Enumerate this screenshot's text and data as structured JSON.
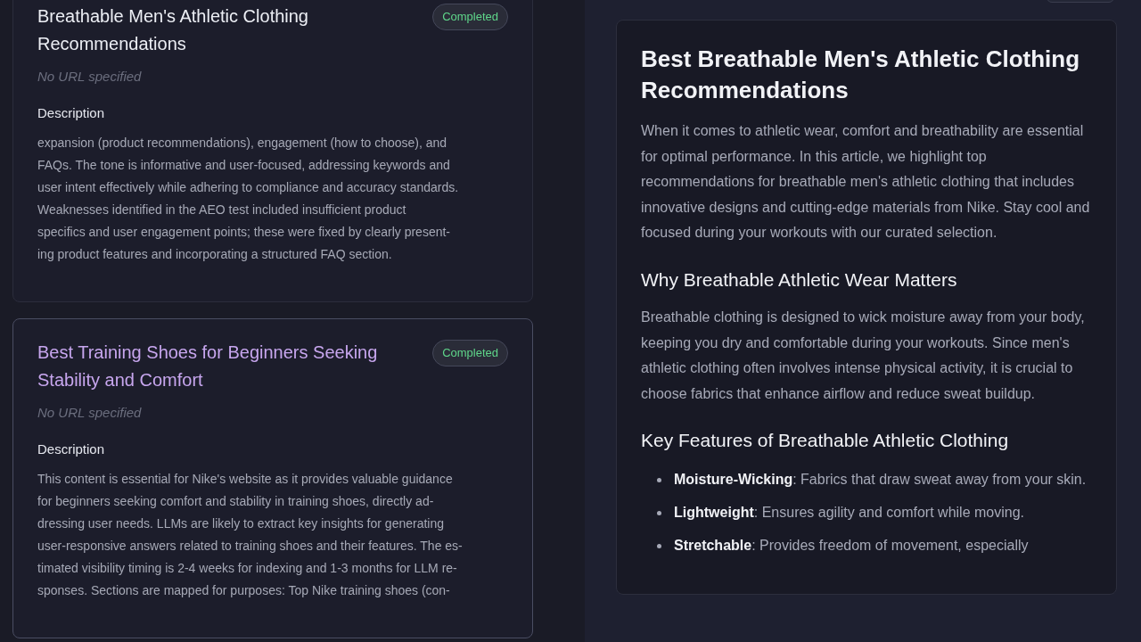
{
  "cards": [
    {
      "title": "Breathable Men's Athletic Clothing Recommendations",
      "selected": false,
      "status": "Completed",
      "url": "No URL specified",
      "description_label": "Description",
      "description_lines": [
        "expansion (product recommendations), engagement (how to choose), and",
        "FAQs. The tone is informative and user-focused, addressing keywords and",
        "user intent effectively while adhering to compliance and accuracy standards.",
        "Weaknesses identified in the AEO test included insufficient product",
        "specifics and user engagement points; these were fixed by clearly present-",
        "ing product features and incorporating a structured FAQ section."
      ]
    },
    {
      "title": "Best Training Shoes for Beginners Seeking Stability and Comfort",
      "selected": true,
      "status": "Completed",
      "url": "No URL specified",
      "description_label": "Description",
      "description_lines": [
        "This content is essential for Nike's website as it provides valuable guidance",
        "for beginners seeking comfort and stability in training shoes, directly ad-",
        "dressing user needs. LLMs are likely to extract key insights for generating",
        "user-responsive answers related to training shoes and their features. The es-",
        "timated visibility timing is 2-4 weeks for indexing and 1-3 months for LLM re-",
        "sponses. Sections are mapped for purposes: Top Nike training shoes (con-"
      ]
    }
  ],
  "article": {
    "blocks": [
      {
        "kind": "h1",
        "text": "Best Breathable Men's Athletic Clothing Recommendations"
      },
      {
        "kind": "p",
        "text": "When it comes to athletic wear, comfort and breathability are essential for optimal performance. In this article, we highlight top recommendations for breathable men's athletic clothing that includes innovative designs and cutting-edge materials from Nike. Stay cool and focused during your workouts with our curated selection."
      },
      {
        "kind": "h2",
        "text": "Why Breathable Athletic Wear Matters"
      },
      {
        "kind": "p",
        "text": "Breathable clothing is designed to wick moisture away from your body, keeping you dry and comfortable during your workouts. Since men's athletic clothing often involves intense physical activity, it is crucial to choose fabrics that enhance airflow and reduce sweat buildup."
      },
      {
        "kind": "h2",
        "text": "Key Features of Breathable Athletic Clothing"
      },
      {
        "kind": "ul",
        "items": [
          "**Moisture-Wicking**: Fabrics that draw sweat away from your skin.",
          "**Lightweight**: Ensures agility and comfort while moving.",
          "**Stretchable**: Provides freedom of movement, especially"
        ]
      }
    ]
  }
}
